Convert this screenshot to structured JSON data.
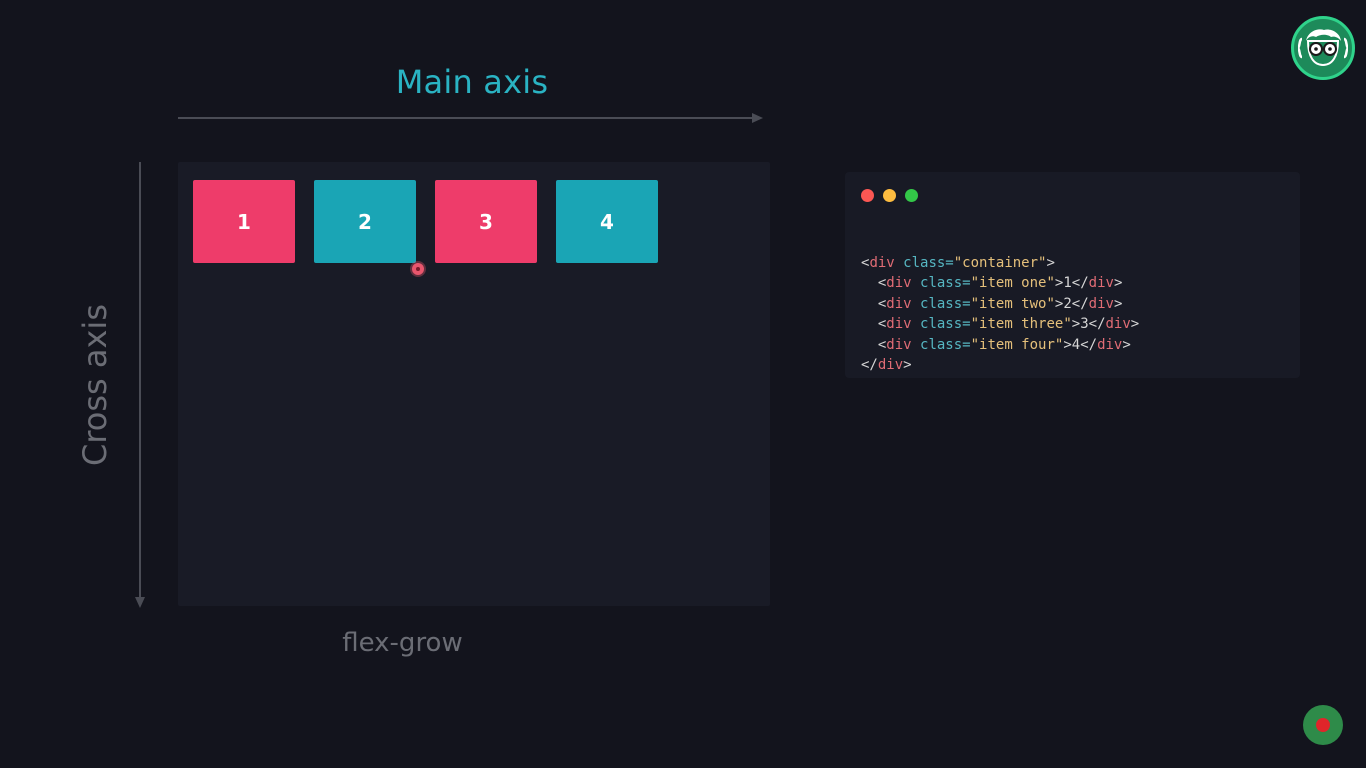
{
  "main_axis": {
    "label": "Main axis"
  },
  "cross_axis": {
    "label": "Cross axis"
  },
  "flex_items": [
    {
      "label": "1",
      "color": "#ee3c6a"
    },
    {
      "label": "2",
      "color": "#1aa5b5"
    },
    {
      "label": "3",
      "color": "#ee3c6a"
    },
    {
      "label": "4",
      "color": "#1aa5b5"
    }
  ],
  "caption": "flex-grow",
  "code_window": {
    "traffic_lights": [
      "#fc5753",
      "#fdbc40",
      "#33c748"
    ],
    "lines": [
      {
        "indent": "",
        "open": "<",
        "tag": "div",
        "attr": " class=",
        "value": "\"container\"",
        "close": ">",
        "text": "",
        "end": ""
      },
      {
        "indent": "  ",
        "open": "<",
        "tag": "div",
        "attr": " class=",
        "value": "\"item one\"",
        "close": ">",
        "text": "1",
        "end": "div"
      },
      {
        "indent": "  ",
        "open": "<",
        "tag": "div",
        "attr": " class=",
        "value": "\"item two\"",
        "close": ">",
        "text": "2",
        "end": "div"
      },
      {
        "indent": "  ",
        "open": "<",
        "tag": "div",
        "attr": " class=",
        "value": "\"item three\"",
        "close": ">",
        "text": "3",
        "end": "div"
      },
      {
        "indent": "  ",
        "open": "<",
        "tag": "div",
        "attr": " class=",
        "value": "\"item four\"",
        "close": ">",
        "text": "4",
        "end": "div"
      },
      {
        "indent": "",
        "open": "</",
        "tag": "div",
        "attr": "",
        "value": "",
        "close": ">",
        "text": "",
        "end": ""
      }
    ]
  },
  "icons": {
    "logo": "nerd-glasses-logo-icon",
    "record": "record-icon"
  }
}
